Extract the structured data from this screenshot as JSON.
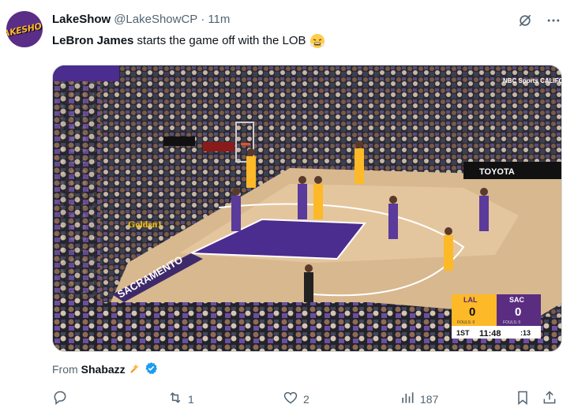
{
  "author": {
    "display_name": "LakeShow",
    "handle": "@LakeShowCP",
    "separator": "·",
    "time": "11m",
    "avatar_text": "LAKESHOW"
  },
  "tweet": {
    "bold_name": "LeBron James",
    "text": " starts the game off with the LOB"
  },
  "video": {
    "network_badge": "NBC Sports CALIFORNIA",
    "home_team": "LAL",
    "away_team": "SAC",
    "home_score": "0",
    "away_score": "0",
    "home_fouls": "FOULS: 0",
    "away_fouls": "FOULS: 0",
    "period": "1ST",
    "clock": "11:48",
    "shot_clock": ":13",
    "ad_toyota": "TOYOTA",
    "ad_golden1": "Golden1",
    "court_text": "SACRAMENTO"
  },
  "source": {
    "prefix": "From",
    "name": "Shabazz"
  },
  "actions": {
    "replies": "",
    "retweets": "1",
    "likes": "2",
    "views": "187"
  },
  "colors": {
    "lakers_gold": "#fdb927",
    "lakers_purple": "#552583",
    "kings_purple": "#5a2d81",
    "verified_blue": "#1d9bf0",
    "muted": "#536471"
  }
}
